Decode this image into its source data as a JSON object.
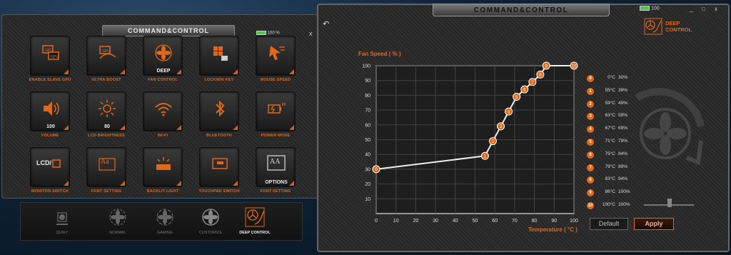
{
  "left_window": {
    "title": "COMMAND&CONTROL",
    "battery": "100 %",
    "close_glyph": "x",
    "tiles": [
      {
        "label": "ENABLE SLAVE GPU",
        "icon": "gpu-icon",
        "value": ""
      },
      {
        "label": "ULTRA BOOST",
        "icon": "gpu-boost-icon",
        "value": ""
      },
      {
        "label": "FAN CONTROL",
        "icon": "fan-icon",
        "value": "DEEP"
      },
      {
        "label": "LOCKWIN KEY",
        "icon": "windows-lock-icon",
        "value": ""
      },
      {
        "label": "MOUSE SPEED",
        "icon": "cursor-speed-icon",
        "value": ""
      },
      {
        "label": "VOLUME",
        "icon": "speaker-icon",
        "value": "100"
      },
      {
        "label": "LCD BRIGHTNESS",
        "icon": "sun-icon",
        "value": "80"
      },
      {
        "label": "WI-FI",
        "icon": "wifi-icon",
        "value": ""
      },
      {
        "label": "BLUETOOTH",
        "icon": "bluetooth-icon",
        "value": ""
      },
      {
        "label": "POWER MODE",
        "icon": "battery-plug-icon",
        "value": ""
      },
      {
        "label": "MONITOR SWITCH",
        "icon": "lcd-monitor-icon",
        "value": ""
      },
      {
        "label": "FONT SETTING",
        "icon": "font-aa-icon",
        "value": ""
      },
      {
        "label": "BACKLIT LIGHT",
        "icon": "keyboard-light-icon",
        "value": ""
      },
      {
        "label": "TOUCHPAD SWITCH",
        "icon": "touchpad-icon",
        "value": ""
      },
      {
        "label": "FONT SETTING",
        "icon": "font-options-icon",
        "value": "OPTIONS"
      }
    ],
    "lcd_text": "LCD/",
    "font_glyph": "Aa",
    "font_glyph2": "AA",
    "modes": [
      {
        "label": "QUIET",
        "active": false
      },
      {
        "label": "NORMAL",
        "active": false
      },
      {
        "label": "GAMING",
        "active": false
      },
      {
        "label": "CUSTOMIZE",
        "active": false
      },
      {
        "label": "DEEP CONTROL",
        "active": true
      }
    ]
  },
  "right_window": {
    "title": "COMMAND&CONTROL",
    "battery": "100",
    "window_buttons": [
      "_",
      "□",
      "x"
    ],
    "back_glyph": "↶",
    "deep_control_label_1": "DEEP",
    "deep_control_label_2": "CONTROL",
    "y_axis_label": "Fan Speed ( % )",
    "x_axis_label": "Temperature ( °C )",
    "legend": [
      {
        "id": "0",
        "temp": "0°C",
        "pct": "30%"
      },
      {
        "id": "1",
        "temp": "55°C",
        "pct": "39%"
      },
      {
        "id": "2",
        "temp": "59°C",
        "pct": "49%"
      },
      {
        "id": "3",
        "temp": "63°C",
        "pct": "59%"
      },
      {
        "id": "4",
        "temp": "67°C",
        "pct": "69%"
      },
      {
        "id": "5",
        "temp": "71°C",
        "pct": "79%"
      },
      {
        "id": "6",
        "temp": "75°C",
        "pct": "84%"
      },
      {
        "id": "7",
        "temp": "79°C",
        "pct": "89%"
      },
      {
        "id": "8",
        "temp": "83°C",
        "pct": "94%"
      },
      {
        "id": "9",
        "temp": "86°C",
        "pct": "100%"
      },
      {
        "id": "10",
        "temp": "100°C",
        "pct": "100%"
      }
    ],
    "default_button": "Default",
    "apply_button": "Apply",
    "accent_color": "#e06818"
  },
  "chart_data": {
    "type": "line",
    "title": "",
    "xlabel": "Temperature ( °C )",
    "ylabel": "Fan Speed ( % )",
    "xlim": [
      0,
      100
    ],
    "ylim": [
      0,
      100
    ],
    "xticks": [
      "0",
      "10",
      "20",
      "30",
      "40",
      "50",
      "60",
      "70",
      "80",
      "90",
      "100"
    ],
    "yticks": [
      "10",
      "20",
      "30",
      "40",
      "50",
      "60",
      "70",
      "80",
      "90",
      "100"
    ],
    "grid": true,
    "series": [
      {
        "point_labels": [
          "0",
          "1",
          "2",
          "3",
          "4",
          "5",
          "6",
          "7",
          "8",
          "9",
          "10"
        ],
        "x": [
          0,
          55,
          59,
          63,
          67,
          71,
          75,
          79,
          83,
          86,
          100
        ],
        "y": [
          30,
          39,
          49,
          59,
          69,
          79,
          84,
          89,
          94,
          100,
          100
        ]
      }
    ]
  }
}
